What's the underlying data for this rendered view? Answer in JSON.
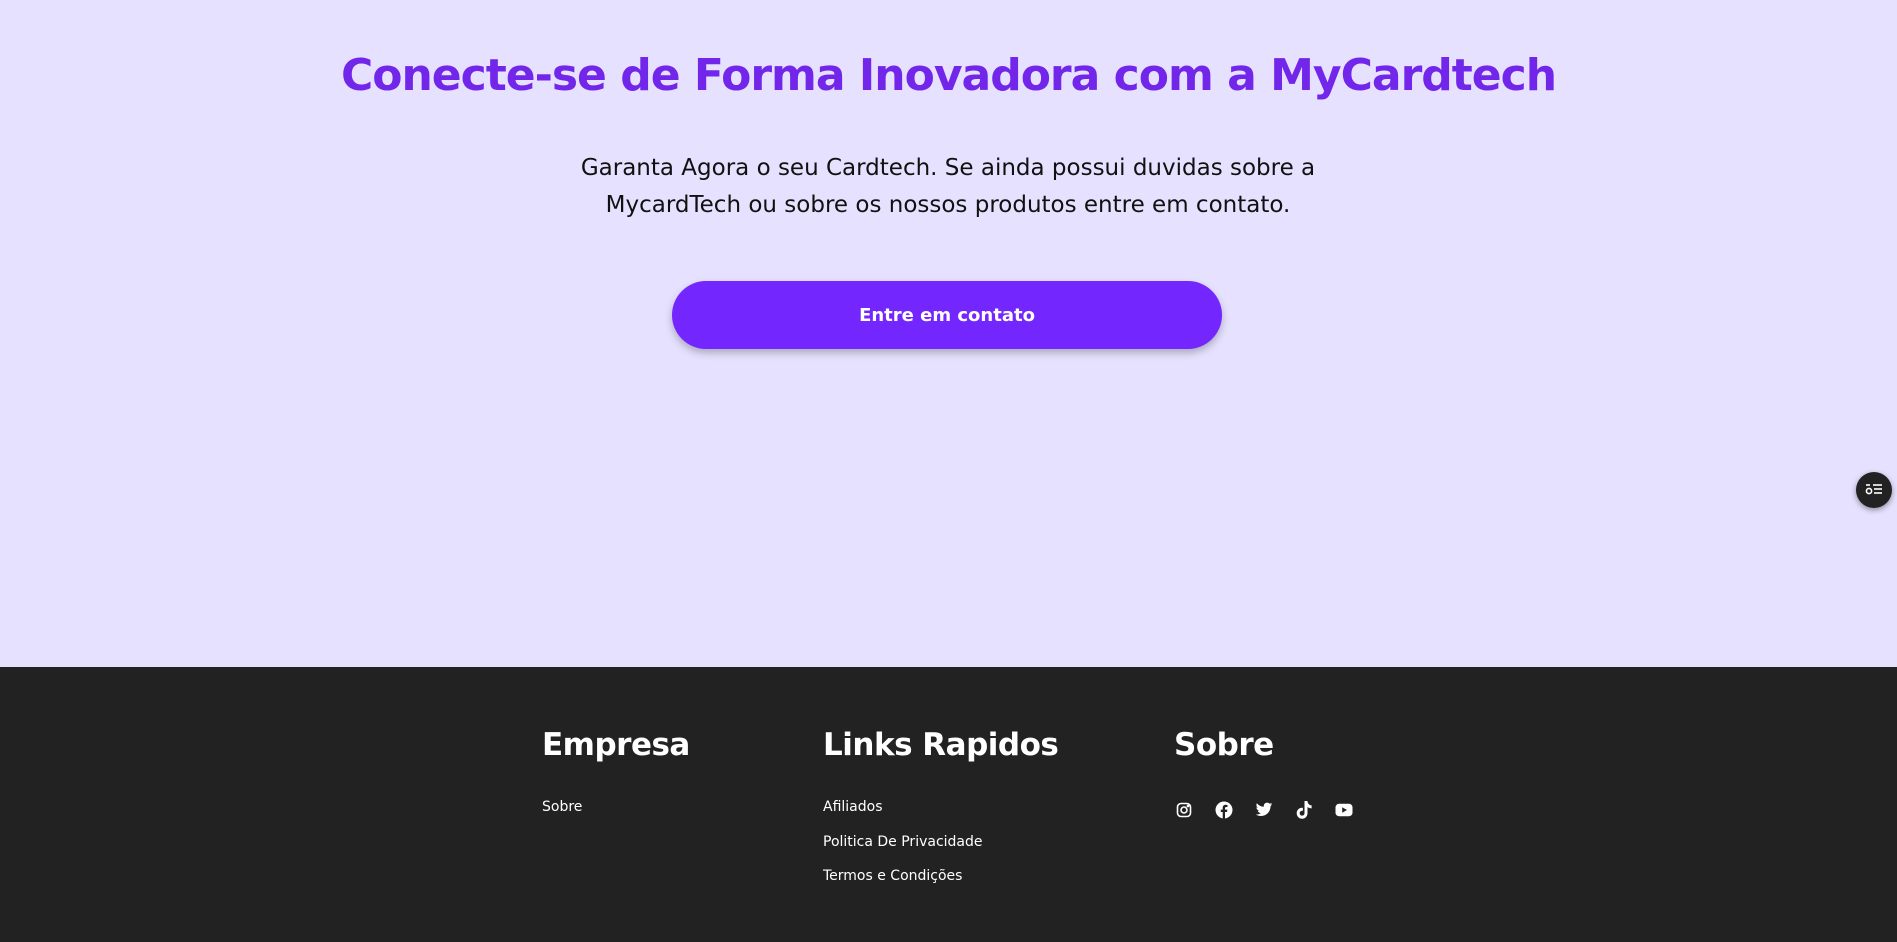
{
  "colors": {
    "accent": "#7426fe",
    "title": "#7126e9",
    "hero_bg": "#e6e1fe",
    "footer_bg": "#222222"
  },
  "hero": {
    "title": "Conecte-se de Forma Inovadora com a MyCardtech",
    "text": "Garanta Agora o seu Cardtech. Se ainda possui duvidas sobre a MycardTech ou sobre os nossos produtos entre em contato.",
    "cta_label": "Entre em contato"
  },
  "floating_button": {
    "icon": "list-settings-icon"
  },
  "footer": {
    "columns": [
      {
        "heading": "Empresa",
        "links": [
          "Sobre"
        ]
      },
      {
        "heading": "Links Rapidos",
        "links": [
          "Afiliados",
          "Politica De Privacidade",
          "Termos e Condições"
        ]
      },
      {
        "heading": "Sobre",
        "socials": [
          "instagram-icon",
          "facebook-icon",
          "twitter-icon",
          "tiktok-icon",
          "youtube-icon"
        ]
      }
    ]
  }
}
